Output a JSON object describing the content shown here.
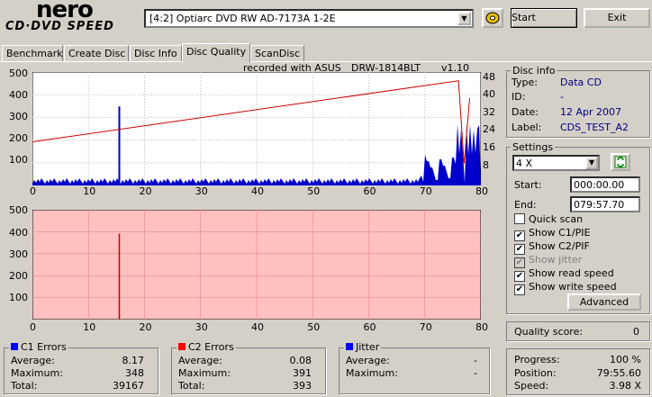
{
  "app": {
    "logo_top": "nero",
    "logo_bottom": "CD·DVD SPEED"
  },
  "toolbar": {
    "drive": "[4:2]  Optiarc DVD RW AD-7173A 1-2E",
    "start_label": "Start",
    "exit_label": "Exit"
  },
  "tabs": [
    "Benchmark",
    "Create Disc",
    "Disc Info",
    "Disc Quality",
    "ScanDisc"
  ],
  "header": {
    "recorded_with": "recorded with ASUS",
    "drive_model": "DRW-1814BLT",
    "version": "v1.10"
  },
  "chart_top": {
    "y_ticks": [
      "500",
      "400",
      "300",
      "200",
      "100"
    ],
    "y2_ticks": [
      "48",
      "40",
      "32",
      "24",
      "16",
      "8"
    ],
    "x_ticks": [
      "0",
      "10",
      "20",
      "30",
      "40",
      "50",
      "60",
      "70",
      "80"
    ]
  },
  "chart_bottom": {
    "y_ticks": [
      "500",
      "400",
      "300",
      "200",
      "100"
    ],
    "x_ticks": [
      "0",
      "10",
      "20",
      "30",
      "40",
      "50",
      "60",
      "70",
      "80"
    ]
  },
  "chart_data": [
    {
      "type": "line",
      "title": "",
      "xlim": [
        0,
        80
      ],
      "ylim": [
        0,
        500
      ],
      "y2lim": [
        0,
        52
      ],
      "series": [
        {
          "values_x": [
            0,
            76,
            77,
            78
          ],
          "values_y": [
            20,
            48,
            10,
            40
          ],
          "axis": "right",
          "color": "#cc0000"
        },
        {
          "values_x": [
            15.5,
            15.5
          ],
          "values_y": [
            0,
            348
          ],
          "color": "#0000cc"
        }
      ]
    },
    {
      "type": "bar",
      "title": "",
      "xlim": [
        0,
        80
      ],
      "ylim": [
        0,
        500
      ],
      "series": [
        {
          "values_x": [
            15.5
          ],
          "values_y": [
            391
          ],
          "color": "#cc0000"
        }
      ]
    }
  ],
  "disc_info": {
    "title": "Disc info",
    "type_label": "Type:",
    "type_value": "Data CD",
    "id_label": "ID:",
    "id_value": "-",
    "date_label": "Date:",
    "date_value": "12 Apr 2007",
    "label_label": "Label:",
    "label_value": "CDS_TEST_A2"
  },
  "settings": {
    "title": "Settings",
    "speed": "4 X",
    "start_label": "Start:",
    "start_value": "000:00.00",
    "end_label": "End:",
    "end_value": "079:57.70",
    "checks": [
      {
        "label": "Quick scan",
        "checked": false,
        "disabled": false
      },
      {
        "label": "Show C1/PIE",
        "checked": true,
        "disabled": false
      },
      {
        "label": "Show C2/PIF",
        "checked": true,
        "disabled": false
      },
      {
        "label": "Show jitter",
        "checked": true,
        "disabled": true
      },
      {
        "label": "Show read speed",
        "checked": true,
        "disabled": false
      },
      {
        "label": "Show write speed",
        "checked": true,
        "disabled": false
      }
    ],
    "advanced_label": "Advanced"
  },
  "quality": {
    "label": "Quality score:",
    "value": "0"
  },
  "progress": {
    "progress_label": "Progress:",
    "progress_value": "100 %",
    "position_label": "Position:",
    "position_value": "79:55.60",
    "speed_label": "Speed:",
    "speed_value": "3.98 X"
  },
  "c1": {
    "title": "C1 Errors",
    "color": "#0000ff",
    "avg_label": "Average:",
    "avg": "8.17",
    "max_label": "Maximum:",
    "max": "348",
    "total_label": "Total:",
    "total": "39167"
  },
  "c2": {
    "title": "C2 Errors",
    "color": "#ff0000",
    "avg_label": "Average:",
    "avg": "0.08",
    "max_label": "Maximum:",
    "max": "391",
    "total_label": "Total:",
    "total": "393"
  },
  "jitter": {
    "title": "Jitter",
    "color": "#0000ff",
    "avg_label": "Average:",
    "avg": "-",
    "max_label": "Maximum:",
    "max": "-"
  }
}
